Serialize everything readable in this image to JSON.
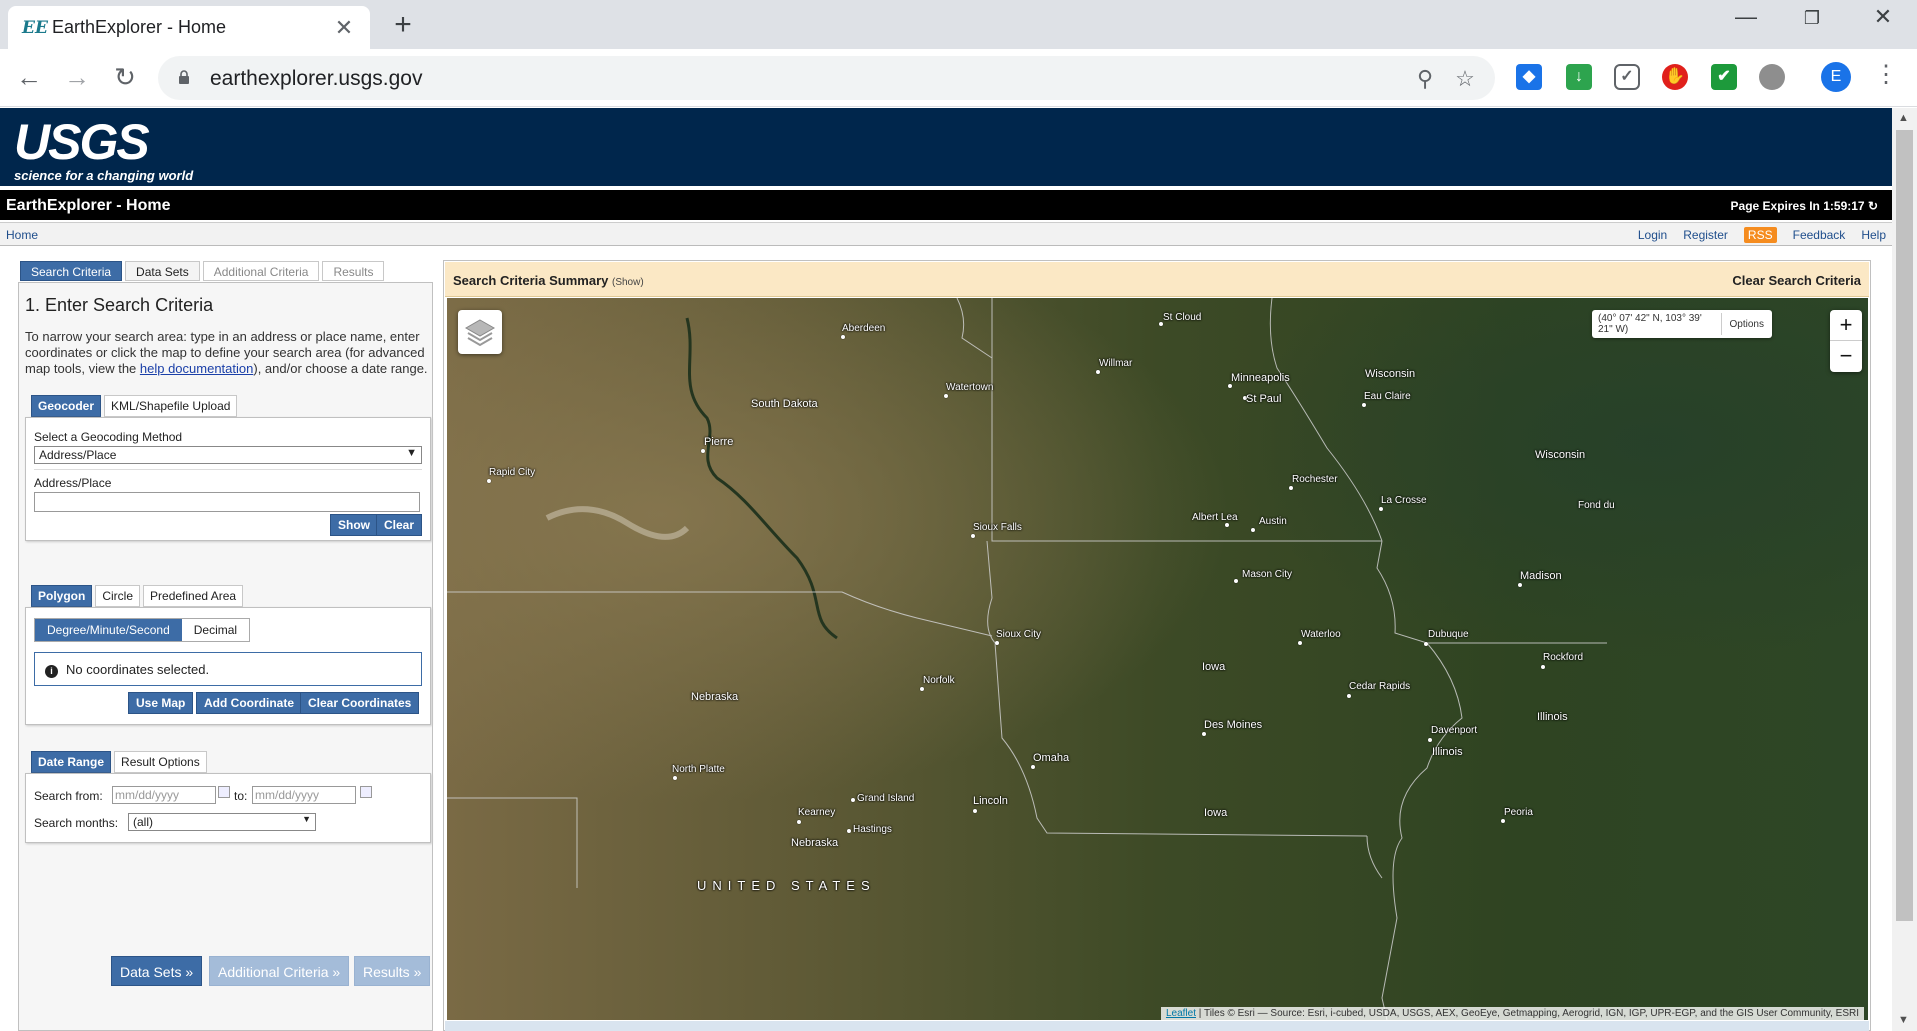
{
  "browser": {
    "tab_title": "EarthExplorer - Home",
    "favicon_text": "EE",
    "url": "earthexplorer.usgs.gov",
    "profile_initial": "E",
    "extensions": [
      {
        "name": "ext-blue-cap",
        "color": "#1a73e8"
      },
      {
        "name": "ext-download",
        "color": "#2da44e"
      },
      {
        "name": "ext-pocket",
        "color": "#5f6368"
      },
      {
        "name": "ext-adblock",
        "color": "#e0201b"
      },
      {
        "name": "ext-checkmark",
        "color": "#1d9a3b"
      },
      {
        "name": "ext-circle",
        "color": "#6e6e6e"
      }
    ]
  },
  "header": {
    "logo_text": "USGS",
    "logo_tagline": "science for a changing world",
    "page_title": "EarthExplorer - Home",
    "expires": "Page Expires In 1:59:17"
  },
  "subnav": {
    "home": "Home",
    "login": "Login",
    "register": "Register",
    "rss": "RSS",
    "feedback": "Feedback",
    "help": "Help"
  },
  "left": {
    "tabs": [
      "Search Criteria",
      "Data Sets",
      "Additional Criteria",
      "Results"
    ],
    "heading": "1. Enter Search Criteria",
    "intro_before": "To narrow your search area: type in an address or place name, enter coordinates or click the map to define your search area (for advanced map tools, view the ",
    "intro_link": "help documentation",
    "intro_after": "), and/or choose a date range.",
    "geo_tabs": [
      "Geocoder",
      "KML/Shapefile Upload"
    ],
    "geo_method_label": "Select a Geocoding Method",
    "geo_method_value": "Address/Place",
    "address_label": "Address/Place",
    "show_btn": "Show",
    "clear_btn": "Clear",
    "area_tabs": [
      "Polygon",
      "Circle",
      "Predefined Area"
    ],
    "coord_modes": [
      "Degree/Minute/Second",
      "Decimal"
    ],
    "no_coords": "No coordinates selected.",
    "use_map": "Use Map",
    "add_coord": "Add Coordinate",
    "clear_coords": "Clear Coordinates",
    "date_tabs": [
      "Date Range",
      "Result Options"
    ],
    "search_from": "Search from:",
    "to": "to:",
    "date_placeholder": "mm/dd/yyyy",
    "search_months": "Search months:",
    "months_value": "(all)",
    "nav_buttons": [
      "Data Sets »",
      "Additional Criteria »",
      "Results »"
    ]
  },
  "summary": {
    "title": "Search Criteria Summary",
    "show": "(Show)",
    "clear": "Clear Search Criteria"
  },
  "map": {
    "coords": "(40° 07' 42\" N, 103° 39' 21\" W)",
    "options": "Options",
    "zoom_in": "+",
    "zoom_out": "−",
    "attribution_link": "Leaflet",
    "attribution_text": " | Tiles © Esri — Source: Esri, i-cubed, USDA, USGS, AEX, GeoEye, Getmapping, Aerogrid, IGN, IGP, UPR-EGP, and the GIS User Community, ESRI",
    "country_label": "UNITED STATES",
    "cities": [
      "Aberdeen",
      "St Cloud",
      "Willmar",
      "Watertown",
      "Minneapolis",
      "St Paul",
      "Wisconsin",
      "Eau Claire",
      "South Dakota",
      "Pierre",
      "Rapid City",
      "Wisconsin",
      "Rochester",
      "La Crosse",
      "Fond du",
      "Albert Lea",
      "Austin",
      "Sioux Falls",
      "Mason City",
      "Madison",
      "Sioux City",
      "Waterloo",
      "Dubuque",
      "Iowa",
      "Rockford",
      "Norfolk",
      "Nebraska",
      "Cedar Rapids",
      "Illinois",
      "Des Moines",
      "Davenport",
      "Illinois",
      "Omaha",
      "North Platte",
      "Grand Island",
      "Lincoln",
      "Kearney",
      "Hastings",
      "Iowa",
      "Peoria",
      "Nebraska"
    ]
  }
}
